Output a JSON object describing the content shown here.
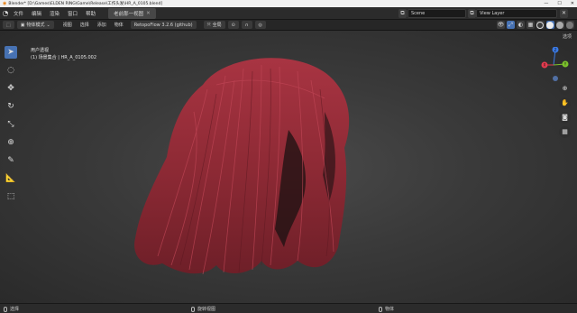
{
  "window": {
    "title": "Blender* [D:\\Games\\ELDEN RING\\Game\\Release\\工作头发\\HR_A_0105.blend]",
    "controls": [
      "—",
      "☐",
      "✕"
    ]
  },
  "topbar": {
    "menus": [
      "文件",
      "编辑",
      "渲染",
      "窗口",
      "帮助"
    ],
    "workspace_tab": "老前那一视图",
    "scene_label": "Scene",
    "view_layer_label": "View Layer"
  },
  "header": {
    "mode": "物体模式",
    "menus": [
      "视图",
      "选择",
      "添加",
      "物体"
    ],
    "addon": "RetopoFlow 3.2.6 (github)",
    "transform_orientation": "全局"
  },
  "viewport": {
    "view_name": "用户透视",
    "object_info": "(1) 场景集合 | HR_A_0105.002",
    "select_label": "选项"
  },
  "gizmo": {
    "x": "X",
    "y": "Y",
    "z": "Z"
  },
  "statusbar": {
    "left": "选择",
    "middle": "旋转视图",
    "right": "物体"
  },
  "colors": {
    "accent": "#4772b3",
    "hair": "#8e2a35",
    "axis_x": "#e53b4f",
    "axis_y": "#7cc22c",
    "axis_z": "#3b7ae5"
  }
}
